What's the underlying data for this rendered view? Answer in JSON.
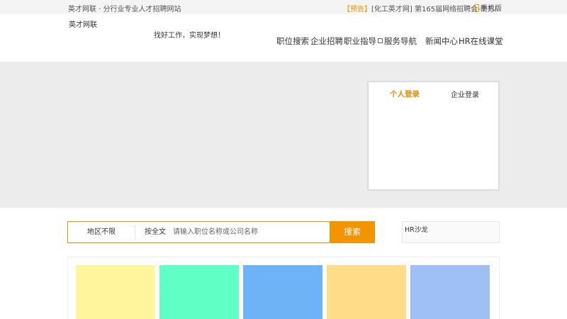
{
  "topbar": {
    "tagline": "英才网联 · 分行业专业人才招聘网站",
    "notice_badge": "【预告】",
    "notice_text": "[化工英才网] 第165届网络招聘会-南方!",
    "mobile_label": "手机版",
    "mobile_icon": "phone-icon",
    "accent": "#f29400"
  },
  "header": {
    "logo_text": "英才网联",
    "slogan": "找好工作，实现梦想！",
    "nav": [
      {
        "label": "职位搜索"
      },
      {
        "label": "企业招聘"
      },
      {
        "label": "职业指导",
        "icon": "external-link-icon"
      },
      {
        "label": "服务导航"
      },
      {
        "label": "新闻中心"
      },
      {
        "label": "HR在线课堂"
      }
    ]
  },
  "login": {
    "tab_personal": "个人登录",
    "tab_company": "企业登录",
    "active_color": "#e58a00"
  },
  "search": {
    "region": "地区不限",
    "mode": "按全文",
    "placeholder": "请输入职位名称或公司名称",
    "button": "搜索"
  },
  "sidebar": {
    "hr_salon": "HR沙龙"
  },
  "cards": [
    {
      "color": "#fff59d"
    },
    {
      "color": "#5fffc6"
    },
    {
      "color": "#6fb3f7"
    },
    {
      "color": "#ffdd88"
    },
    {
      "color": "#9fbff7"
    }
  ]
}
